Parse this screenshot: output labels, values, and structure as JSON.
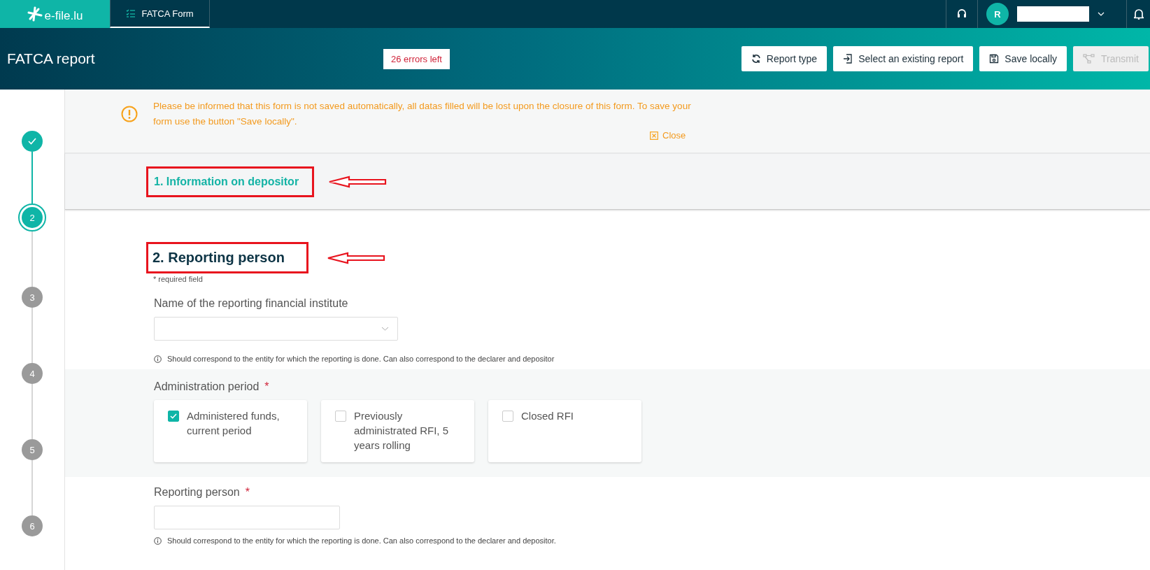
{
  "top_nav": {
    "logo": "e-file.lu",
    "tabs": [
      {
        "label": "FATCA Form",
        "selected": true
      }
    ],
    "user_initial": "R"
  },
  "header": {
    "title": "FATCA report",
    "errors_badge": "26 errors left",
    "buttons": [
      {
        "label": "Report type",
        "kind": "refresh",
        "disabled": false
      },
      {
        "label": "Select an existing report",
        "kind": "import",
        "disabled": false
      },
      {
        "label": "Save locally",
        "kind": "save",
        "disabled": false
      },
      {
        "label": "Transmit",
        "kind": "network",
        "disabled": true
      }
    ]
  },
  "steps": [
    {
      "done": true,
      "selected": false
    },
    {
      "label": "2",
      "done": false,
      "selected": true
    },
    {
      "label": "3",
      "done": false,
      "selected": false
    },
    {
      "label": "4",
      "done": false,
      "selected": false
    },
    {
      "label": "5",
      "done": false,
      "selected": false
    },
    {
      "label": "6",
      "done": false,
      "selected": false
    }
  ],
  "notice": {
    "text": "Please be informed that this form is not saved automatically, all datas filled will be lost upon the closure of this form. To save your form use the button \"Save locally\".",
    "close": "Close"
  },
  "section_1": {
    "title": "1. Information on depositor",
    "annotated": true
  },
  "section_2": {
    "title": "2. Reporting person",
    "annotated": true,
    "required_note": "* required field",
    "fields": [
      {
        "kind": "dropdown",
        "label": "Name of the reporting financial institute",
        "hint": "Should correspond to the entity for which the reporting is done. Can also correspond to the declarer and depositor"
      },
      {
        "kind": "checkboxes",
        "label": "Administration period",
        "required_mark": "*",
        "options": [
          {
            "label": "Administered funds, current period",
            "checked": true
          },
          {
            "label": "Previously administrated RFI, 5 years rolling",
            "checked": false
          },
          {
            "label": "Closed RFI",
            "checked": false
          }
        ]
      },
      {
        "kind": "text",
        "label": "Reporting person",
        "required_mark": "*",
        "hint": "Should correspond to the entity for which the reporting is done. Can also correspond to the declarer and depositor."
      }
    ]
  }
}
